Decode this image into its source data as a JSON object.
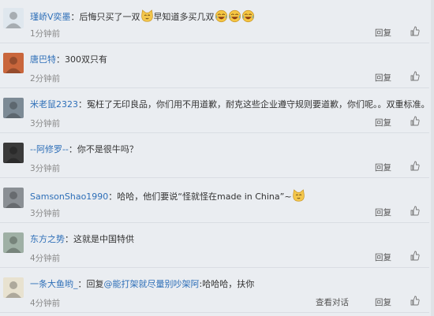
{
  "comments": [
    {
      "username": "瑾峤V奕墨",
      "parts": [
        {
          "type": "text",
          "value": "后悔只买了一双"
        },
        {
          "type": "emoji",
          "icon": "meow-emoji"
        },
        {
          "type": "text",
          "value": "早知道多买几双"
        },
        {
          "type": "emoji",
          "icon": "laugh-emoji"
        },
        {
          "type": "emoji",
          "icon": "laugh-emoji"
        },
        {
          "type": "emoji",
          "icon": "laugh-emoji"
        }
      ],
      "time": "1分钟前",
      "reply": "回复",
      "avatar_color": "#dfe7ee"
    },
    {
      "username": "唐巴特",
      "parts": [
        {
          "type": "text",
          "value": "300双只有"
        }
      ],
      "time": "2分钟前",
      "reply": "回复",
      "avatar_color": "#c9663c"
    },
    {
      "username": "米老鼠2323",
      "parts": [
        {
          "type": "text",
          "value": "冤枉了无印良品，你们用不用道歉，耐克这些企业遵守规则要道歉，你们呢。。双重标准。"
        }
      ],
      "time": "3分钟前",
      "reply": "回复",
      "avatar_color": "#7c8a95"
    },
    {
      "username": "--阿修罗--",
      "parts": [
        {
          "type": "text",
          "value": "你不是很牛吗？"
        }
      ],
      "time": "3分钟前",
      "reply": "回复",
      "avatar_color": "#3a3a3a"
    },
    {
      "username": "SamsonShao1990",
      "parts": [
        {
          "type": "text",
          "value": "哈哈，他们要说“怪就怪在made in China”~"
        },
        {
          "type": "emoji",
          "icon": "meow-emoji"
        }
      ],
      "time": "3分钟前",
      "reply": "回复",
      "avatar_color": "#8a8f94"
    },
    {
      "username": "东方之势",
      "parts": [
        {
          "type": "text",
          "value": "这就是中国特供"
        }
      ],
      "time": "4分钟前",
      "reply": "回复",
      "avatar_color": "#9fb0a5"
    },
    {
      "username": "一条大鱼哟_",
      "parts": [
        {
          "type": "text",
          "value": "回复"
        },
        {
          "type": "mention",
          "value": "@能打架就尽量别吵架阿"
        },
        {
          "type": "text",
          "value": ":哈哈哈，扶你"
        }
      ],
      "time": "4分钟前",
      "view_conversation": "查看对话",
      "reply": "回复",
      "avatar_color": "#e8e2d0"
    }
  ],
  "colors": {
    "background": "#eaedf1",
    "username": "#2e6fb8",
    "time": "#8a8a8a"
  }
}
